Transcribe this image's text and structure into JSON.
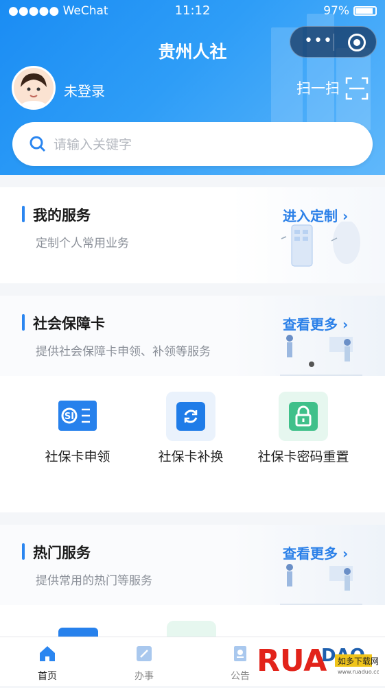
{
  "status_bar": {
    "carrier": "●●●●● WeChat",
    "time": "11:12",
    "battery": "97%"
  },
  "app": {
    "title": "贵州人社",
    "capsule_more_icon": "more-dots-icon",
    "capsule_close_icon": "target-icon"
  },
  "user": {
    "name": "未登录",
    "scan_label": "扫一扫"
  },
  "search": {
    "placeholder": "请输入关键字"
  },
  "sections": {
    "my_services": {
      "title": "我的服务",
      "subtitle": "定制个人常用业务",
      "link": "进入定制"
    },
    "social_card": {
      "title": "社会保障卡",
      "subtitle": "提供社会保障卡申领、补领等服务",
      "link": "查看更多",
      "items": [
        {
          "label": "社保卡申领",
          "icon": "card-apply-icon"
        },
        {
          "label": "社保卡补换",
          "icon": "card-replace-icon"
        },
        {
          "label": "社保卡密码重置",
          "icon": "lock-icon"
        }
      ]
    },
    "hot_services": {
      "title": "热门服务",
      "subtitle": "提供常用的热门等服务",
      "link": "查看更多"
    }
  },
  "tabbar": [
    {
      "label": "首页",
      "icon": "home-icon",
      "active": true
    },
    {
      "label": "办事",
      "icon": "edit-icon",
      "active": false
    },
    {
      "label": "公告",
      "icon": "notice-icon",
      "active": false
    }
  ],
  "watermark": {
    "brand": "RUANDAO",
    "sub": "如多下载网",
    "url": "www.ruaduo.com"
  },
  "colors": {
    "primary": "#2b86f0",
    "header": "#1a8cf3",
    "link": "#2b80e8"
  }
}
